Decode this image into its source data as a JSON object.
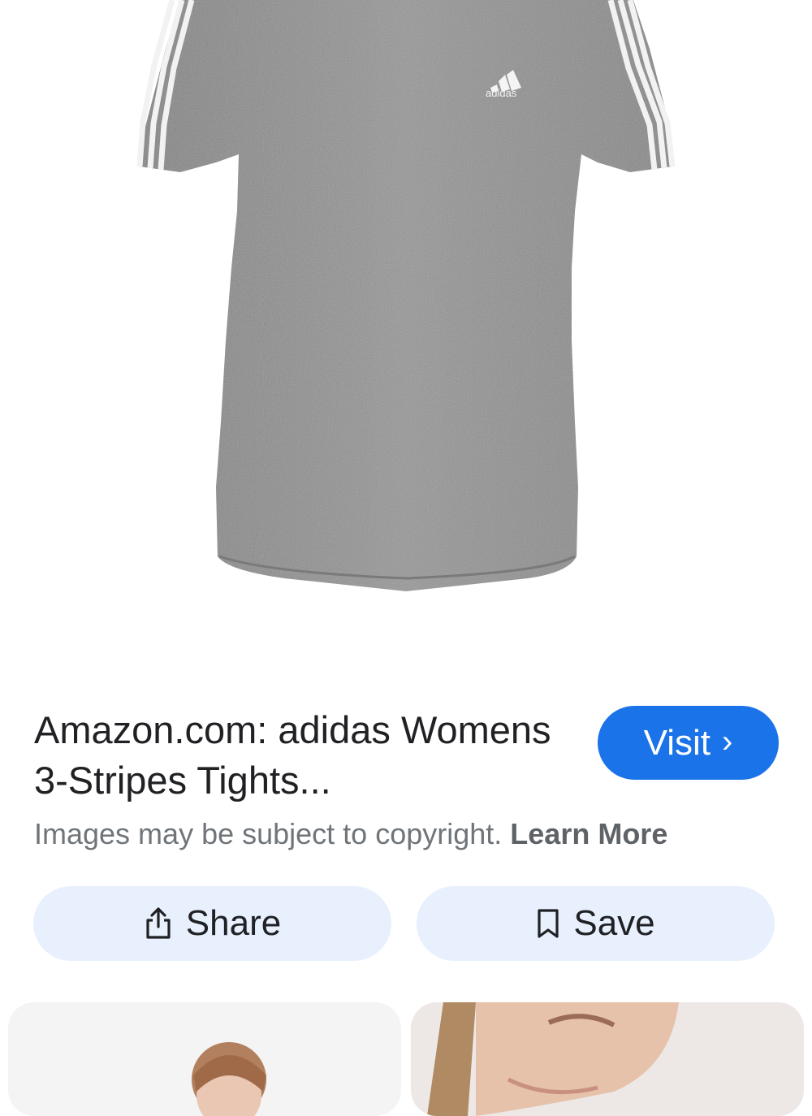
{
  "product": {
    "image_alt": "adidas women's grey heather t-shirt with white 3-stripes",
    "logo_text": "adidas",
    "title": "Amazon.com: adidas Womens 3-Stripes Tights...",
    "visit_label": "Visit",
    "visit_icon": "chevron-right-icon"
  },
  "notice": {
    "text": "Images may be subject to copyright.",
    "link_label": "Learn More"
  },
  "actions": {
    "share_label": "Share",
    "share_icon": "share-icon",
    "save_label": "Save",
    "save_icon": "bookmark-icon"
  },
  "colors": {
    "accent": "#1a73e8",
    "action_bg": "#e8f0fe",
    "shirt_grey": "#8f8f8f"
  }
}
